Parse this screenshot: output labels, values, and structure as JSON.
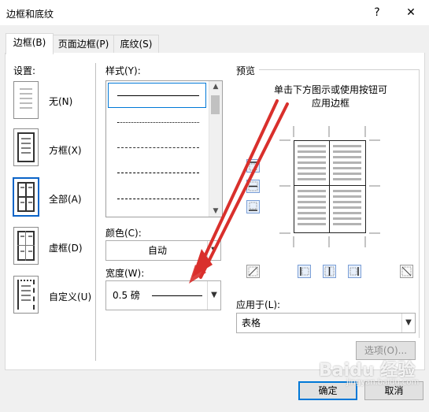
{
  "window": {
    "title": "边框和底纹",
    "help_label": "?",
    "close_label": "✕"
  },
  "tabs": [
    {
      "label": "边框(B)",
      "active": true
    },
    {
      "label": "页面边框(P)",
      "active": false
    },
    {
      "label": "底纹(S)",
      "active": false
    }
  ],
  "settings": {
    "heading": "设置:",
    "items": [
      {
        "label": "无(N)"
      },
      {
        "label": "方框(X)"
      },
      {
        "label": "全部(A)"
      },
      {
        "label": "虚框(D)"
      },
      {
        "label": "自定义(U)"
      }
    ]
  },
  "style": {
    "heading": "样式(Y):",
    "lines": [
      "solid",
      "dotted",
      "dashed-fine",
      "dashed",
      "dash-dot"
    ]
  },
  "color": {
    "heading": "颜色(C):",
    "value": "自动"
  },
  "width": {
    "heading": "宽度(W):",
    "value": "0.5 磅"
  },
  "preview": {
    "heading": "预览",
    "instructions": "单击下方图示或使用按钮可\n应用边框"
  },
  "apply_to": {
    "heading": "应用于(L):",
    "value": "表格"
  },
  "buttons": {
    "options": "选项(O)...",
    "ok": "确定",
    "cancel": "取消"
  },
  "watermark": {
    "text": "Baidu 经验",
    "subtext": "jingyan.baidu.com"
  },
  "colors": {
    "accent": "#0078d7",
    "arrow": "#d9302c"
  }
}
